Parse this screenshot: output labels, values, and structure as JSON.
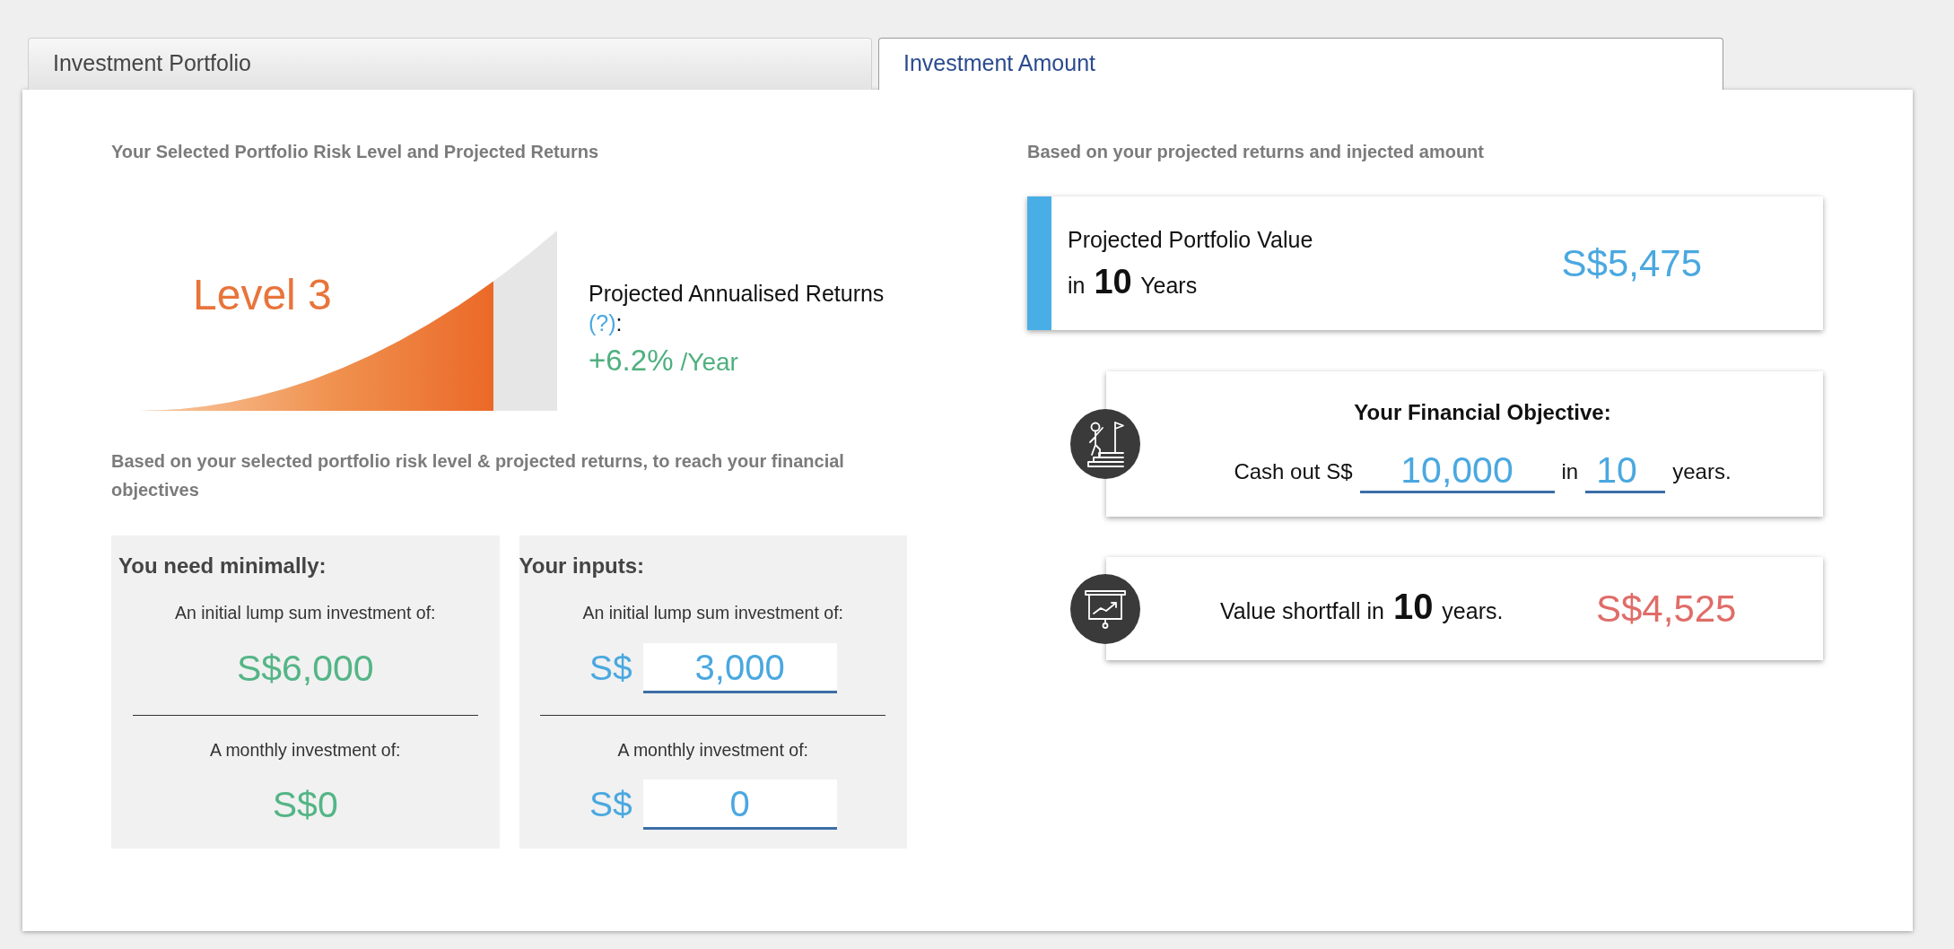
{
  "tabs": [
    {
      "label": "Investment Portfolio",
      "selected": false
    },
    {
      "label": "Investment Amount",
      "selected": true
    }
  ],
  "left": {
    "heading": "Your Selected Portfolio Risk Level and Projected Returns",
    "risk": {
      "label": "Level 3",
      "returns_label": "Projected Annualised Returns",
      "help_link": "(?)",
      "help_suffix": ":",
      "rate": "+6.2%",
      "rate_unit": "/Year"
    },
    "objective_heading": "Based on your selected portfolio risk level & projected returns, to reach your financial objectives",
    "panels": [
      {
        "kind": "result",
        "title": "You need minimally:",
        "items": [
          {
            "label": "An initial lump sum investment of:",
            "value": "S$6,000"
          },
          {
            "label": "A monthly investment of:",
            "value": "S$0"
          }
        ]
      },
      {
        "kind": "input",
        "title": "Your inputs:",
        "items": [
          {
            "label": "An initial lump sum investment of:",
            "currency": "S$",
            "value": "3,000"
          },
          {
            "label": "A monthly investment of:",
            "currency": "S$",
            "value": "0"
          }
        ]
      }
    ]
  },
  "right": {
    "heading": "Based on your projected returns and injected amount",
    "projection": {
      "label": "Projected Portfolio Value",
      "years_text": "in **10** Years",
      "value": "S$5,475"
    },
    "objective": {
      "title": "Your Financial Objective:",
      "prefix": "Cash out S$",
      "amount": "10,000",
      "middle": "in",
      "years": "10",
      "suffix": "years."
    },
    "shortfall": {
      "text": "Value shortfall in **10** years.",
      "value": "S$4,525"
    }
  }
}
